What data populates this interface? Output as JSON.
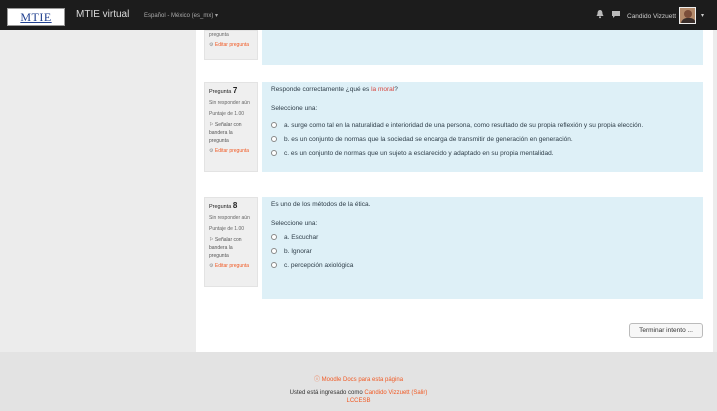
{
  "navbar": {
    "logo": "MTIE",
    "brand": "MTIE virtual",
    "language": "Español - México (es_mx) ▾",
    "user_name": "Candido Vizzuett",
    "caret": "▾"
  },
  "top_partial": {
    "flag_text": "pregunta",
    "edit_label": "Editar pregunta"
  },
  "questions": [
    {
      "label": "Pregunta",
      "number": "7",
      "status": "Sin responder aún",
      "score": "Puntaje de 1.00",
      "flag": "Señalar con bandera la pregunta",
      "edit": "Editar pregunta",
      "text_before": "Responde correctamente ¿qué es ",
      "text_highlight": "la moral",
      "text_after": "?",
      "select_label": "Seleccione una:",
      "options": [
        "a. surge como tal en la naturalidad e interioridad de una persona, como resultado de su propia reflexión y su propia elección.",
        "b. es un conjunto de normas que la sociedad se encarga de transmitir de generación en generación.",
        "c. es un conjunto de normas que un sujeto a esclarecido y adaptado en su propia mentalidad."
      ]
    },
    {
      "label": "Pregunta",
      "number": "8",
      "status": "Sin responder aún",
      "score": "Puntaje de 1.00",
      "flag": "Señalar con bandera la pregunta",
      "edit": "Editar pregunta",
      "text_before": "Es uno de los métodos de la ética.",
      "text_highlight": "",
      "text_after": "",
      "select_label": "Seleccione una:",
      "options": [
        "a. Escuchar",
        "b. Ignorar",
        "c. percepción axiológica"
      ]
    }
  ],
  "finish_button": "Terminar intento ...",
  "footer": {
    "docs_link": "Moodle Docs para esta página",
    "logged_prefix": "Usted está ingresado como ",
    "logged_user": "Candido Vizzuett",
    "logout": "(Salir)",
    "course": "LCCESB"
  }
}
